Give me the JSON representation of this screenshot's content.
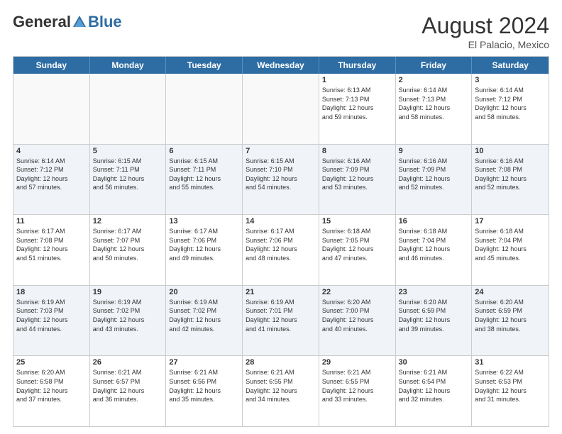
{
  "header": {
    "logo": {
      "general": "General",
      "blue": "Blue"
    },
    "month_year": "August 2024",
    "location": "El Palacio, Mexico"
  },
  "days_of_week": [
    "Sunday",
    "Monday",
    "Tuesday",
    "Wednesday",
    "Thursday",
    "Friday",
    "Saturday"
  ],
  "rows": [
    {
      "alt": false,
      "cells": [
        {
          "day": "",
          "info": ""
        },
        {
          "day": "",
          "info": ""
        },
        {
          "day": "",
          "info": ""
        },
        {
          "day": "",
          "info": ""
        },
        {
          "day": "1",
          "info": "Sunrise: 6:13 AM\nSunset: 7:13 PM\nDaylight: 12 hours\nand 59 minutes."
        },
        {
          "day": "2",
          "info": "Sunrise: 6:14 AM\nSunset: 7:13 PM\nDaylight: 12 hours\nand 58 minutes."
        },
        {
          "day": "3",
          "info": "Sunrise: 6:14 AM\nSunset: 7:12 PM\nDaylight: 12 hours\nand 58 minutes."
        }
      ]
    },
    {
      "alt": true,
      "cells": [
        {
          "day": "4",
          "info": "Sunrise: 6:14 AM\nSunset: 7:12 PM\nDaylight: 12 hours\nand 57 minutes."
        },
        {
          "day": "5",
          "info": "Sunrise: 6:15 AM\nSunset: 7:11 PM\nDaylight: 12 hours\nand 56 minutes."
        },
        {
          "day": "6",
          "info": "Sunrise: 6:15 AM\nSunset: 7:11 PM\nDaylight: 12 hours\nand 55 minutes."
        },
        {
          "day": "7",
          "info": "Sunrise: 6:15 AM\nSunset: 7:10 PM\nDaylight: 12 hours\nand 54 minutes."
        },
        {
          "day": "8",
          "info": "Sunrise: 6:16 AM\nSunset: 7:09 PM\nDaylight: 12 hours\nand 53 minutes."
        },
        {
          "day": "9",
          "info": "Sunrise: 6:16 AM\nSunset: 7:09 PM\nDaylight: 12 hours\nand 52 minutes."
        },
        {
          "day": "10",
          "info": "Sunrise: 6:16 AM\nSunset: 7:08 PM\nDaylight: 12 hours\nand 52 minutes."
        }
      ]
    },
    {
      "alt": false,
      "cells": [
        {
          "day": "11",
          "info": "Sunrise: 6:17 AM\nSunset: 7:08 PM\nDaylight: 12 hours\nand 51 minutes."
        },
        {
          "day": "12",
          "info": "Sunrise: 6:17 AM\nSunset: 7:07 PM\nDaylight: 12 hours\nand 50 minutes."
        },
        {
          "day": "13",
          "info": "Sunrise: 6:17 AM\nSunset: 7:06 PM\nDaylight: 12 hours\nand 49 minutes."
        },
        {
          "day": "14",
          "info": "Sunrise: 6:17 AM\nSunset: 7:06 PM\nDaylight: 12 hours\nand 48 minutes."
        },
        {
          "day": "15",
          "info": "Sunrise: 6:18 AM\nSunset: 7:05 PM\nDaylight: 12 hours\nand 47 minutes."
        },
        {
          "day": "16",
          "info": "Sunrise: 6:18 AM\nSunset: 7:04 PM\nDaylight: 12 hours\nand 46 minutes."
        },
        {
          "day": "17",
          "info": "Sunrise: 6:18 AM\nSunset: 7:04 PM\nDaylight: 12 hours\nand 45 minutes."
        }
      ]
    },
    {
      "alt": true,
      "cells": [
        {
          "day": "18",
          "info": "Sunrise: 6:19 AM\nSunset: 7:03 PM\nDaylight: 12 hours\nand 44 minutes."
        },
        {
          "day": "19",
          "info": "Sunrise: 6:19 AM\nSunset: 7:02 PM\nDaylight: 12 hours\nand 43 minutes."
        },
        {
          "day": "20",
          "info": "Sunrise: 6:19 AM\nSunset: 7:02 PM\nDaylight: 12 hours\nand 42 minutes."
        },
        {
          "day": "21",
          "info": "Sunrise: 6:19 AM\nSunset: 7:01 PM\nDaylight: 12 hours\nand 41 minutes."
        },
        {
          "day": "22",
          "info": "Sunrise: 6:20 AM\nSunset: 7:00 PM\nDaylight: 12 hours\nand 40 minutes."
        },
        {
          "day": "23",
          "info": "Sunrise: 6:20 AM\nSunset: 6:59 PM\nDaylight: 12 hours\nand 39 minutes."
        },
        {
          "day": "24",
          "info": "Sunrise: 6:20 AM\nSunset: 6:59 PM\nDaylight: 12 hours\nand 38 minutes."
        }
      ]
    },
    {
      "alt": false,
      "cells": [
        {
          "day": "25",
          "info": "Sunrise: 6:20 AM\nSunset: 6:58 PM\nDaylight: 12 hours\nand 37 minutes."
        },
        {
          "day": "26",
          "info": "Sunrise: 6:21 AM\nSunset: 6:57 PM\nDaylight: 12 hours\nand 36 minutes."
        },
        {
          "day": "27",
          "info": "Sunrise: 6:21 AM\nSunset: 6:56 PM\nDaylight: 12 hours\nand 35 minutes."
        },
        {
          "day": "28",
          "info": "Sunrise: 6:21 AM\nSunset: 6:55 PM\nDaylight: 12 hours\nand 34 minutes."
        },
        {
          "day": "29",
          "info": "Sunrise: 6:21 AM\nSunset: 6:55 PM\nDaylight: 12 hours\nand 33 minutes."
        },
        {
          "day": "30",
          "info": "Sunrise: 6:21 AM\nSunset: 6:54 PM\nDaylight: 12 hours\nand 32 minutes."
        },
        {
          "day": "31",
          "info": "Sunrise: 6:22 AM\nSunset: 6:53 PM\nDaylight: 12 hours\nand 31 minutes."
        }
      ]
    }
  ]
}
